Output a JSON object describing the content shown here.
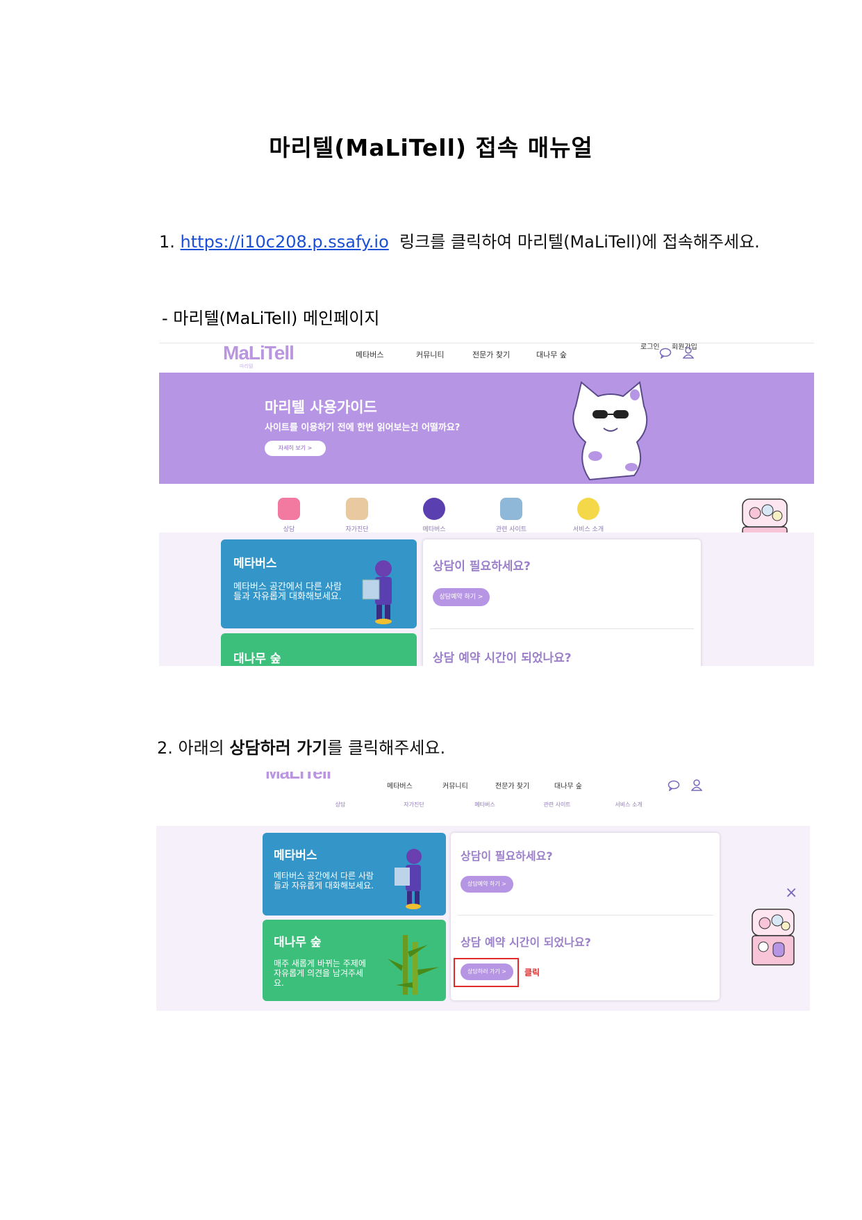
{
  "doc": {
    "title": "마리텔(MaLiTell)  접속  매뉴얼",
    "step1_num": "1.",
    "step1_link": "https://i10c208.p.ssafy.io",
    "step1_text": "링크를  클릭하여  마리텔(MaLiTell)에  접속해주세요.",
    "sub_caption": "-  마리텔(MaLiTell)  메인페이지",
    "step2_prefix": "2.  아래의 ",
    "step2_bold": "상담하러  가기",
    "step2_suffix": "를  클릭해주세요."
  },
  "site": {
    "logo": "MaLiTell",
    "logo_sub": "마리텔",
    "top_links": {
      "login": "로그인",
      "signup": "회원가입"
    },
    "nav": [
      "메타버스",
      "커뮤니티",
      "전문가 찾기",
      "대나무 숲"
    ],
    "banner": {
      "title": "마리텔 사용가이드",
      "subtitle": "사이트를 이용하기 전에 한번 읽어보는건 어떨까요?",
      "button": "자세히 보기 >"
    },
    "quick": [
      "상담",
      "자가진단",
      "메타버스",
      "관련 사이트",
      "서비스 소개"
    ],
    "cards": {
      "metaverse": {
        "title": "메타버스",
        "desc": "메타버스 공간에서 다른 사람들과 자유롭게 대화해보세요."
      },
      "bamboo": {
        "title": "대나무 숲",
        "desc": "매주 새롭게 바뀌는 주제에 자유롭게 의견을 남겨주세요."
      }
    },
    "panel": {
      "q1": "상담이 필요하세요?",
      "b1": "상담예약 하기 >",
      "q2": "상담 예약 시간이 되었나요?",
      "b2": "상담하러 가기 >"
    },
    "click_label": "클릭",
    "close": "×"
  },
  "colors": {
    "accent": "#b795e5",
    "metaverse_card": "#3395c8",
    "bamboo_card": "#3dbf7c",
    "highlight": "#e02b2b"
  }
}
